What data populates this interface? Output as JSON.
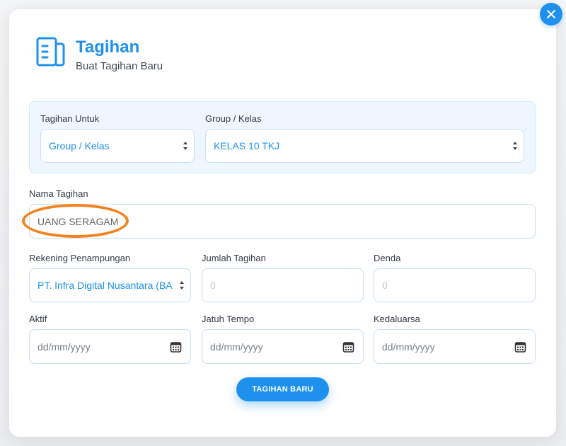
{
  "header": {
    "title": "Tagihan",
    "subtitle": "Buat Tagihan Baru",
    "icon": "document-list-icon"
  },
  "colors": {
    "accent": "#1e90ee",
    "highlight": "#f58220"
  },
  "form": {
    "tagihan_untuk": {
      "label": "Tagihan Untuk",
      "value": "Group / Kelas"
    },
    "group_kelas": {
      "label": "Group / Kelas",
      "value": "KELAS 10 TKJ"
    },
    "nama_tagihan": {
      "label": "Nama Tagihan",
      "value": "UANG SERAGAM"
    },
    "rekening": {
      "label": "Rekening Penampungan",
      "value": "PT. Infra Digital Nusantara (BA"
    },
    "jumlah": {
      "label": "Jumlah Tagihan",
      "placeholder": "0"
    },
    "denda": {
      "label": "Denda",
      "placeholder": "0"
    },
    "aktif": {
      "label": "Aktif",
      "placeholder": "dd/mm/yyyy"
    },
    "jatuh_tempo": {
      "label": "Jatuh Tempo",
      "placeholder": "dd/mm/yyyy"
    },
    "kedaluarsa": {
      "label": "Kedaluarsa",
      "placeholder": "dd/mm/yyyy"
    }
  },
  "actions": {
    "submit_label": "TAGIHAN BARU"
  }
}
